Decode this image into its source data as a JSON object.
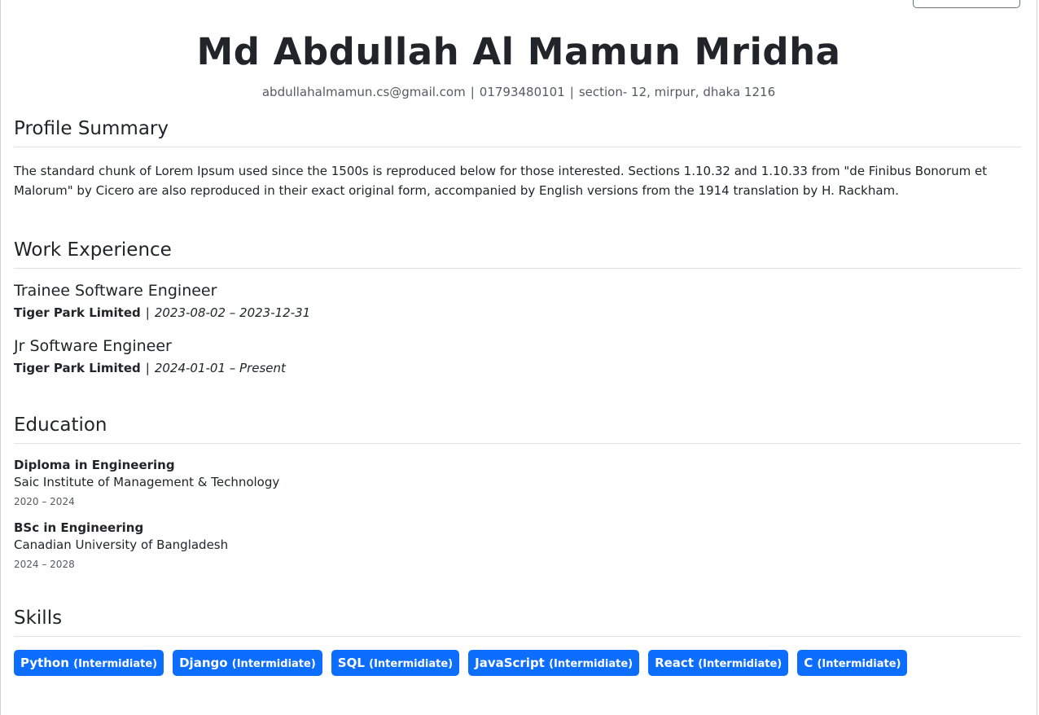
{
  "header": {
    "name": "Md Abdullah Al Mamun Mridha",
    "email": "abdullahalmamun.cs@gmail.com",
    "phone": "01793480101",
    "address": "section- 12, mirpur, dhaka 1216",
    "separator": "|"
  },
  "summary": {
    "title": "Profile Summary",
    "text": "The standard chunk of Lorem Ipsum used since the 1500s is reproduced below for those interested. Sections 1.10.32 and 1.10.33 from \"de Finibus Bonorum et Malorum\" by Cicero are also reproduced in their exact original form, accompanied by English versions from the 1914 translation by H. Rackham."
  },
  "work": {
    "title": "Work Experience",
    "jobs": [
      {
        "title": "Trainee Software Engineer",
        "company": "Tiger Park Limited",
        "dates": "2023-08-02 – 2023-12-31"
      },
      {
        "title": "Jr Software Engineer",
        "company": "Tiger Park Limited",
        "dates": "2024-01-01 – Present"
      }
    ]
  },
  "education": {
    "title": "Education",
    "items": [
      {
        "degree": "Diploma in Engineering",
        "school": "Saic Institute of Management & Technology",
        "years": "2020 – 2024"
      },
      {
        "degree": "BSc in Engineering",
        "school": "Canadian University of Bangladesh",
        "years": "2024 – 2028"
      }
    ]
  },
  "skills": {
    "title": "Skills",
    "items": [
      {
        "name": "Python",
        "level": "(Intermidiate)"
      },
      {
        "name": "Django",
        "level": "(Intermidiate)"
      },
      {
        "name": "SQL",
        "level": "(Intermidiate)"
      },
      {
        "name": "JavaScript",
        "level": "(Intermidiate)"
      },
      {
        "name": "React",
        "level": "(Intermidiate)"
      },
      {
        "name": "C",
        "level": "(Intermidiate)"
      }
    ],
    "badge_color": "#0d6efd"
  }
}
